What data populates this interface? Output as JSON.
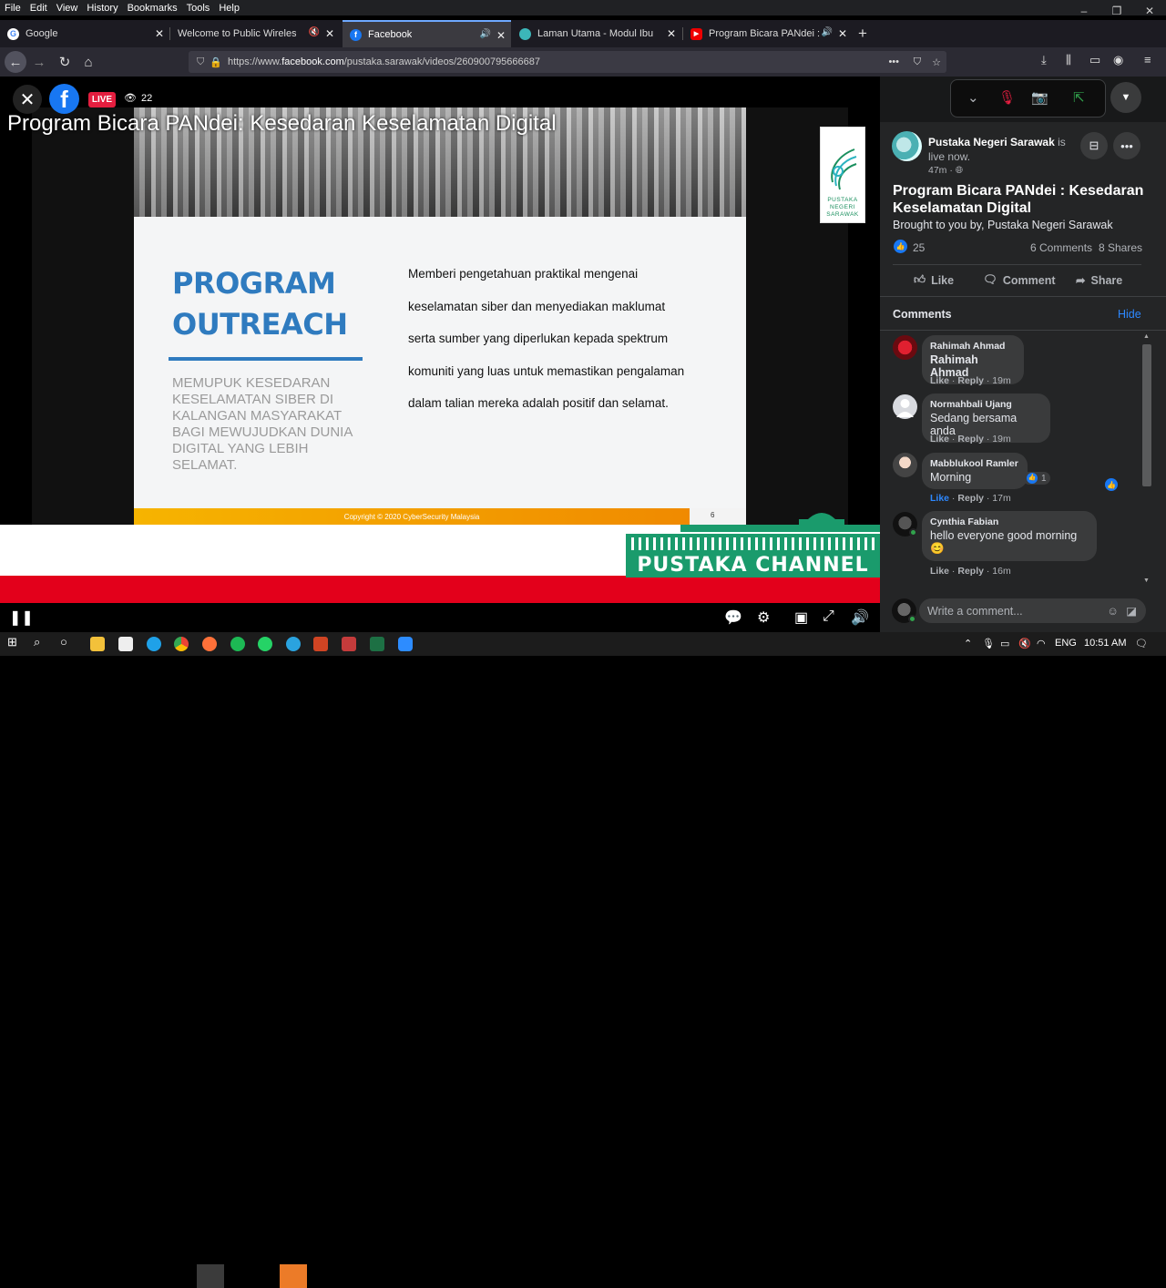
{
  "menu": [
    "File",
    "Edit",
    "View",
    "History",
    "Bookmarks",
    "Tools",
    "Help"
  ],
  "window_controls": [
    "–",
    "❐",
    "✕"
  ],
  "tabs": [
    {
      "label": "Google",
      "favicon": "google-icon",
      "active": false
    },
    {
      "label": "Welcome to Public Wireless Net",
      "favicon": "none",
      "active": false
    },
    {
      "label": "Facebook",
      "favicon": "facebook-icon",
      "active": true
    },
    {
      "label": "Laman Utama - Modul Ibu Bap",
      "favicon": "site-icon",
      "active": false
    },
    {
      "label": "Program Bicara PANdei : Ke",
      "favicon": "youtube-icon",
      "active": false
    }
  ],
  "new_tab": "+",
  "url": {
    "prefix": "https://www.",
    "domain": "facebook.com",
    "path": "/pustaka.sarawak/videos/260900795666687"
  },
  "video": {
    "title": "Program Bicara PANdei: Kesedaran Keselamatan Digital",
    "live_label": "LIVE",
    "viewer_count": "22",
    "slide_heading_1": "PROGRAM",
    "slide_heading_2": "OUTREACH",
    "slide_sub": "MEMUPUK KESEDARAN KESELAMATAN SIBER DI KALANGAN MASYARAKAT BAGI MEWUJUDKAN DUNIA DIGITAL YANG LEBIH SELAMAT.",
    "slide_desc": [
      "Memberi pengetahuan praktikal mengenai",
      "keselamatan siber dan menyediakan maklumat",
      "serta sumber yang diperlukan kepada spektrum",
      "komuniti yang luas untuk memastikan pengalaman",
      "dalam talian mereka adalah positif dan selamat."
    ],
    "slide_copyright": "Copyright © 2020 CyberSecurity Malaysia",
    "slide_page": "6",
    "logo_text": [
      "PUSTAKA",
      "NEGERI",
      "SARAWAK"
    ],
    "channel_brand": "PUSTAKA CHANNEL"
  },
  "post": {
    "page_name": "Pustaka Negeri Sarawak",
    "live_suffix": "is live now.",
    "time": "47m · ",
    "title": "Program Bicara PANdei : Kesedaran Keselamatan Digital",
    "byline": "Brought to you by, Pustaka Negeri Sarawak",
    "reactions": "25",
    "comments_count": "6 Comments",
    "shares_count": "8 Shares",
    "actions": {
      "like": "Like",
      "comment": "Comment",
      "share": "Share"
    },
    "comments_heading": "Comments",
    "hide_label": "Hide"
  },
  "comments": [
    {
      "name": "Rahimah Ahmad",
      "text": "Rahimah Ahmad",
      "like": "Like",
      "reply": "Reply",
      "time": "19m",
      "reactions": ""
    },
    {
      "name": "Normahbali Ujang",
      "text": "Sedang bersama anda",
      "like": "Like",
      "reply": "Reply",
      "time": "19m",
      "reactions": ""
    },
    {
      "name": "Mabblukool Ramler",
      "text": "Morning",
      "like": "Like",
      "reply": "Reply",
      "time": "17m",
      "reactions": "1"
    },
    {
      "name": "Cynthia Fabian",
      "text": "hello everyone good morning",
      "emoji": "😊",
      "like": "Like",
      "reply": "Reply",
      "time": "16m",
      "reactions": ""
    }
  ],
  "write_comment_placeholder": "Write a comment...",
  "taskbar": {
    "lang": "ENG",
    "time": "10:51 AM"
  },
  "colors": {
    "facebook_blue": "#1877f2",
    "live_red": "#e41e3f",
    "slide_blue": "#2f7bbf",
    "channel_green": "#1a9b6c",
    "link_blue": "#2d88ff"
  }
}
